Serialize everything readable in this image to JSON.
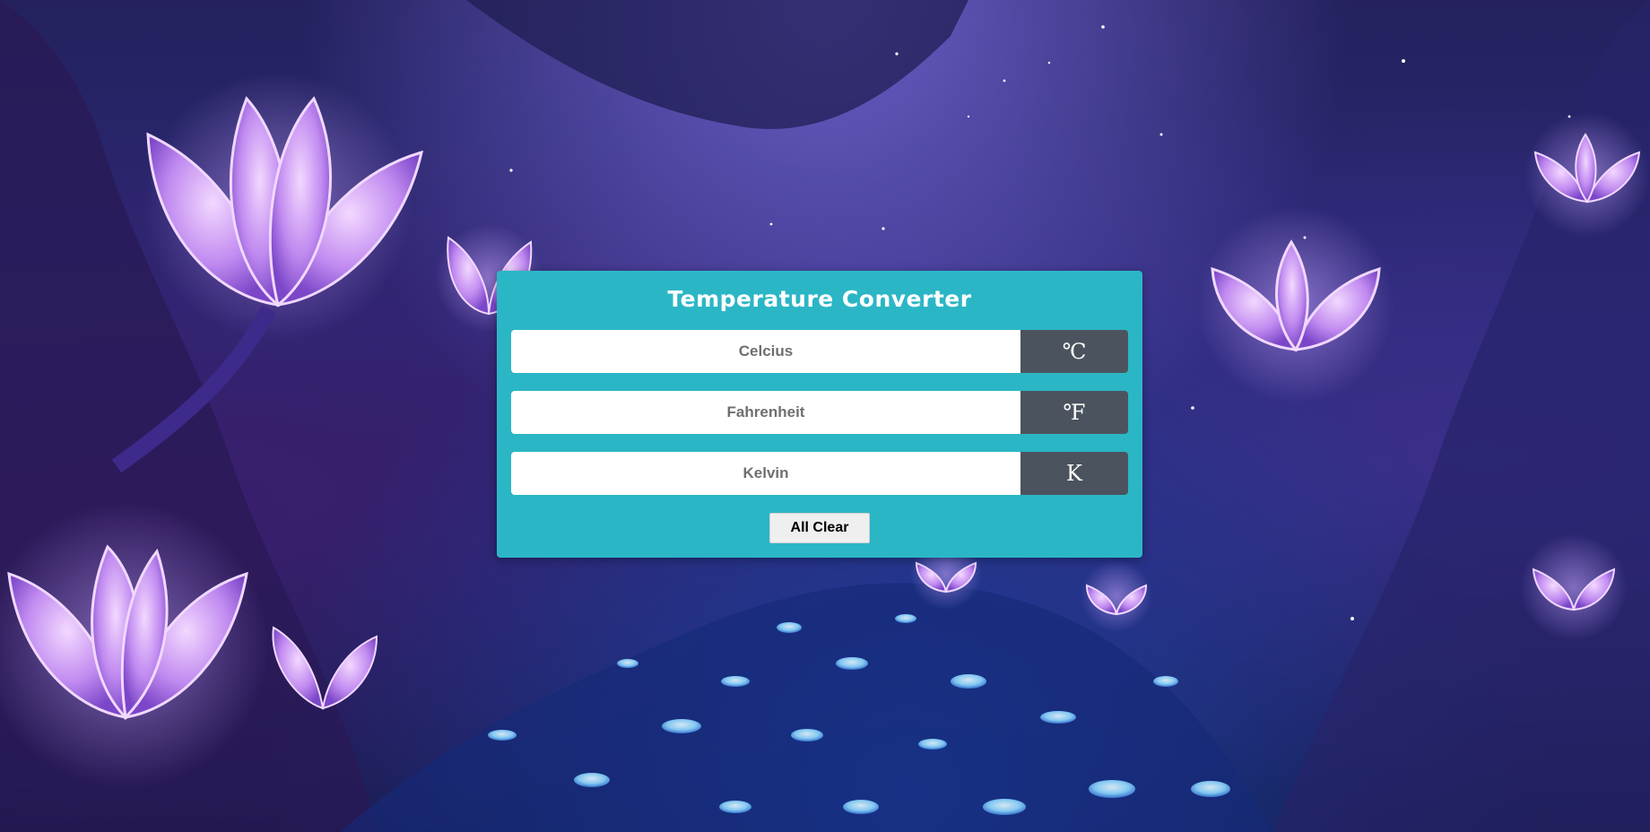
{
  "colors": {
    "panel_bg": "#2bb6c6",
    "unit_bg": "#4b545e",
    "input_bg": "#ffffff",
    "button_bg": "#efefef"
  },
  "converter": {
    "title": "Temperature Converter",
    "fields": [
      {
        "placeholder": "Celcius",
        "value": "",
        "unit": "℃"
      },
      {
        "placeholder": "Fahrenheit",
        "value": "",
        "unit": "℉"
      },
      {
        "placeholder": "Kelvin",
        "value": "",
        "unit": "K"
      }
    ],
    "clear_label": "All Clear"
  }
}
